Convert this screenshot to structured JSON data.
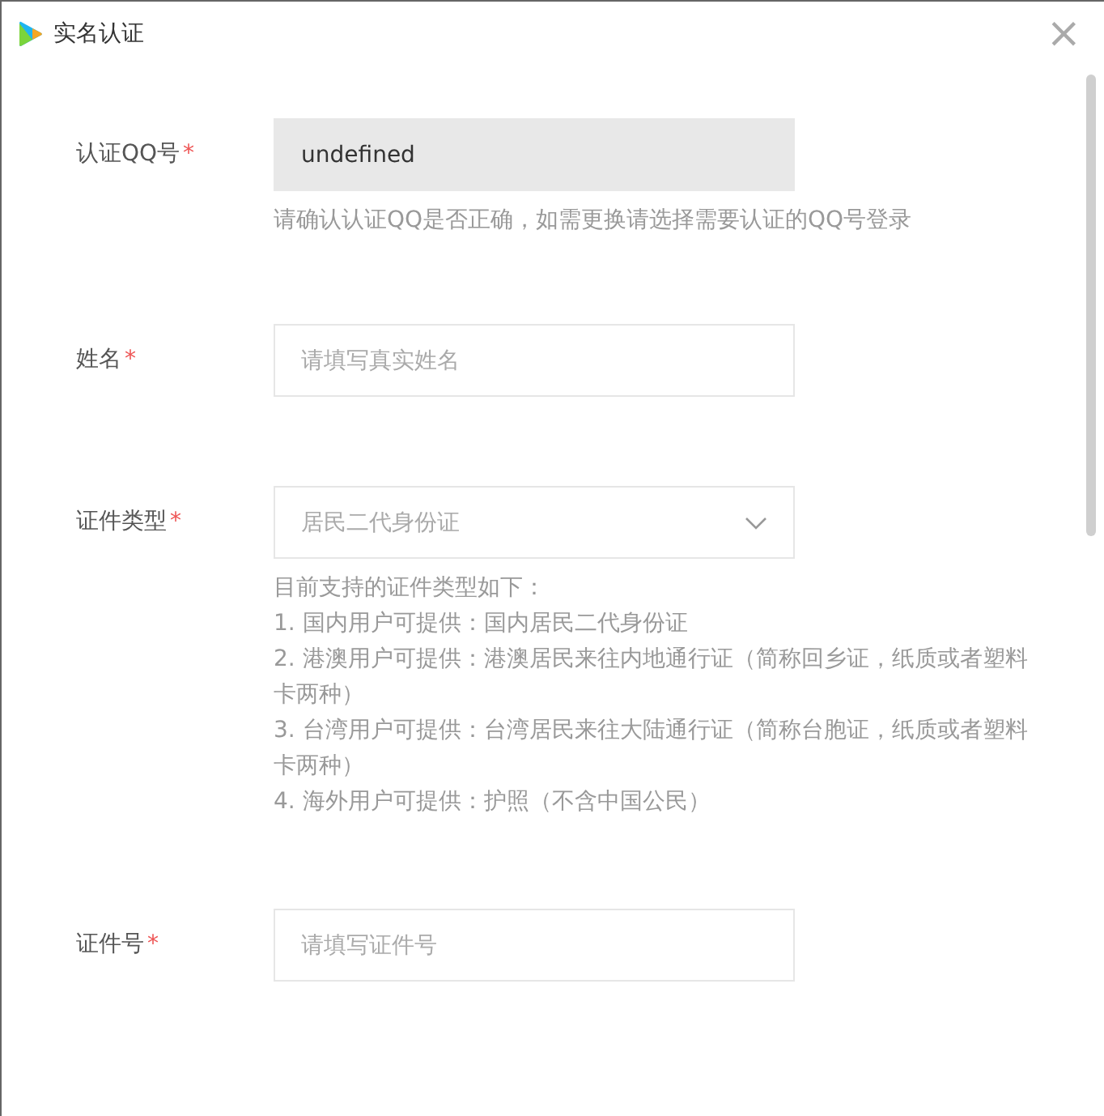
{
  "window": {
    "title": "实名认证",
    "close": "×"
  },
  "fields": [
    {
      "kind": "readonly",
      "label": "认证QQ号",
      "required_mark": "*",
      "value": "undefined",
      "hint": "请确认认证QQ是否正确，如需更换请选择需要认证的QQ号登录"
    },
    {
      "kind": "text",
      "label": "姓名",
      "required_mark": "*",
      "placeholder": "请填写真实姓名"
    },
    {
      "kind": "select",
      "label": "证件类型",
      "required_mark": "*",
      "placeholder": "居民二代身份证",
      "notes": [
        "目前支持的证件类型如下：",
        "1. 国内用户可提供：国内居民二代身份证",
        "2. 港澳用户可提供：港澳居民来往内地通行证（简称回乡证，纸质或者塑料卡两种）",
        "3. 台湾用户可提供：台湾居民来往大陆通行证（简称台胞证，纸质或者塑料卡两种）",
        "4. 海外用户可提供：护照（不含中国公民）"
      ]
    },
    {
      "kind": "text",
      "label": "证件号",
      "required_mark": "*",
      "placeholder": "请填写证件号"
    }
  ]
}
